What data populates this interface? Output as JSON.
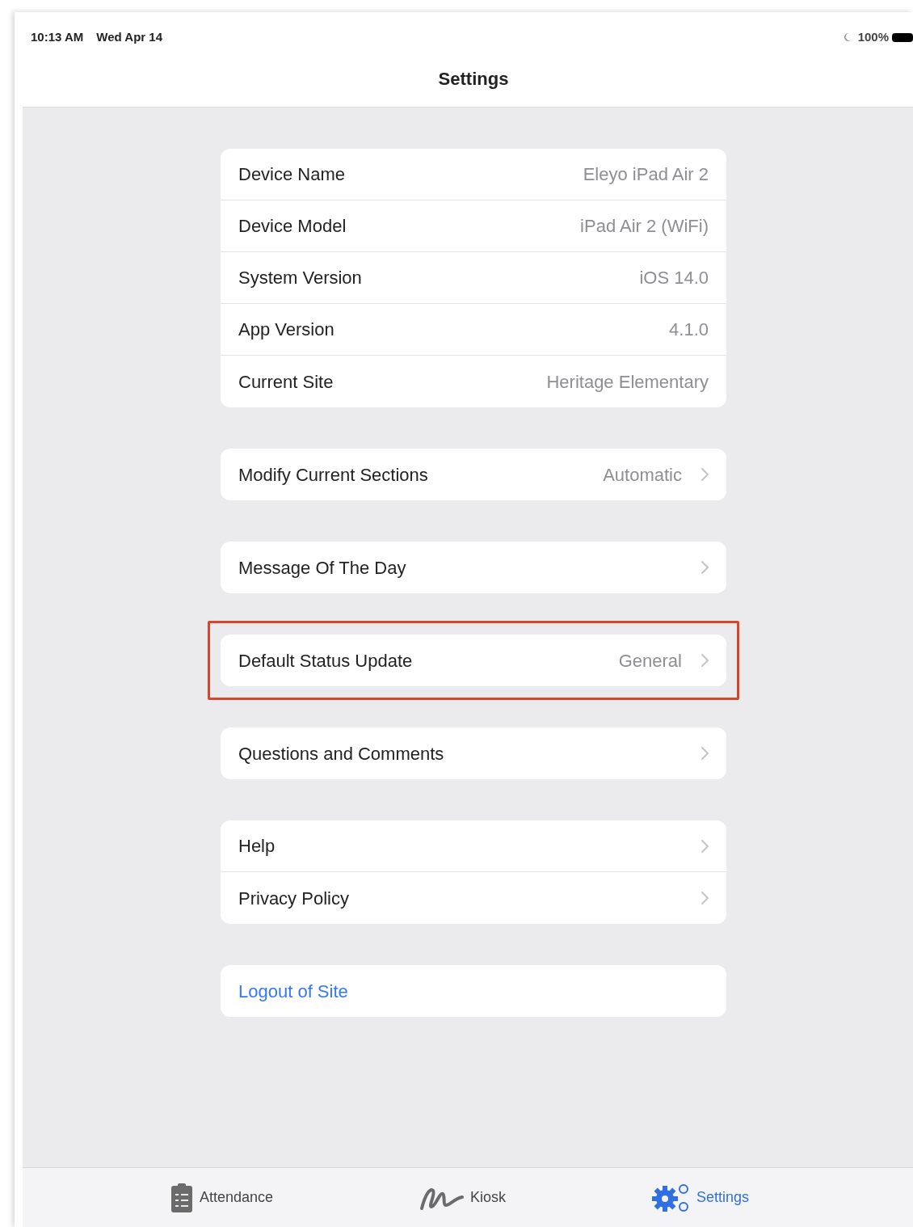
{
  "status_bar": {
    "time": "10:13 AM",
    "date": "Wed Apr 14",
    "battery": "100%"
  },
  "navigation": {
    "title": "Settings"
  },
  "groups": [
    {
      "highlighted": false,
      "rows": [
        {
          "kind": "info",
          "label": "Device Name",
          "value": "Eleyo iPad Air 2"
        },
        {
          "kind": "info",
          "label": "Device Model",
          "value": "iPad Air 2 (WiFi)"
        },
        {
          "kind": "info",
          "label": "System Version",
          "value": "iOS 14.0"
        },
        {
          "kind": "info",
          "label": "App Version",
          "value": "4.1.0"
        },
        {
          "kind": "info",
          "label": "Current Site",
          "value": "Heritage Elementary"
        }
      ]
    },
    {
      "highlighted": false,
      "rows": [
        {
          "kind": "nav",
          "label": "Modify Current Sections",
          "value": "Automatic"
        }
      ]
    },
    {
      "highlighted": false,
      "rows": [
        {
          "kind": "nav",
          "label": "Message Of The Day"
        }
      ]
    },
    {
      "highlighted": true,
      "rows": [
        {
          "kind": "nav",
          "label": "Default Status Update",
          "value": "General"
        }
      ]
    },
    {
      "highlighted": false,
      "rows": [
        {
          "kind": "nav",
          "label": "Questions and Comments"
        }
      ]
    },
    {
      "highlighted": false,
      "rows": [
        {
          "kind": "nav",
          "label": "Help"
        },
        {
          "kind": "nav",
          "label": "Privacy Policy"
        }
      ]
    },
    {
      "highlighted": false,
      "rows": [
        {
          "kind": "action",
          "label": "Logout of Site"
        }
      ]
    }
  ],
  "tab_bar": [
    {
      "label": "Attendance",
      "selected": false
    },
    {
      "label": "Kiosk",
      "selected": false
    },
    {
      "label": "Settings",
      "selected": true
    }
  ]
}
